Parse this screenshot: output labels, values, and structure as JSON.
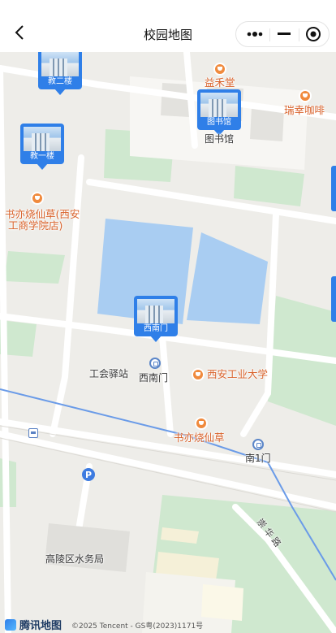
{
  "nav": {
    "title": "校园地图"
  },
  "markers": {
    "jiaoer": "教二楼",
    "jiaoyi": "教一楼",
    "library": "图书馆",
    "xinanmen": "西南门"
  },
  "pois": {
    "yihetang": "益禾堂",
    "ruixing": "瑞幸咖啡",
    "shuyi_school_line1": "书亦烧仙草(西安",
    "shuyi_school_line2": "工商学院店)",
    "shuyi_south": "书亦烧仙草",
    "xian_tech_univ": "西安工业大学",
    "gonghui": "工会驿站",
    "xinanmen": "西南门",
    "nan1men": "南1门",
    "library_under": "图书馆",
    "water_bureau": "高陵区水务局",
    "road_name": "崇 华 路"
  },
  "footer": {
    "brand": "腾讯地图",
    "copyright": "©2025 Tencent - GS粤(2023)1171号"
  },
  "colors": {
    "marker": "#2f7fe8",
    "poi_orange": "#f08a3d",
    "water": "#a9cdf2",
    "green": "#cfe8cf"
  }
}
